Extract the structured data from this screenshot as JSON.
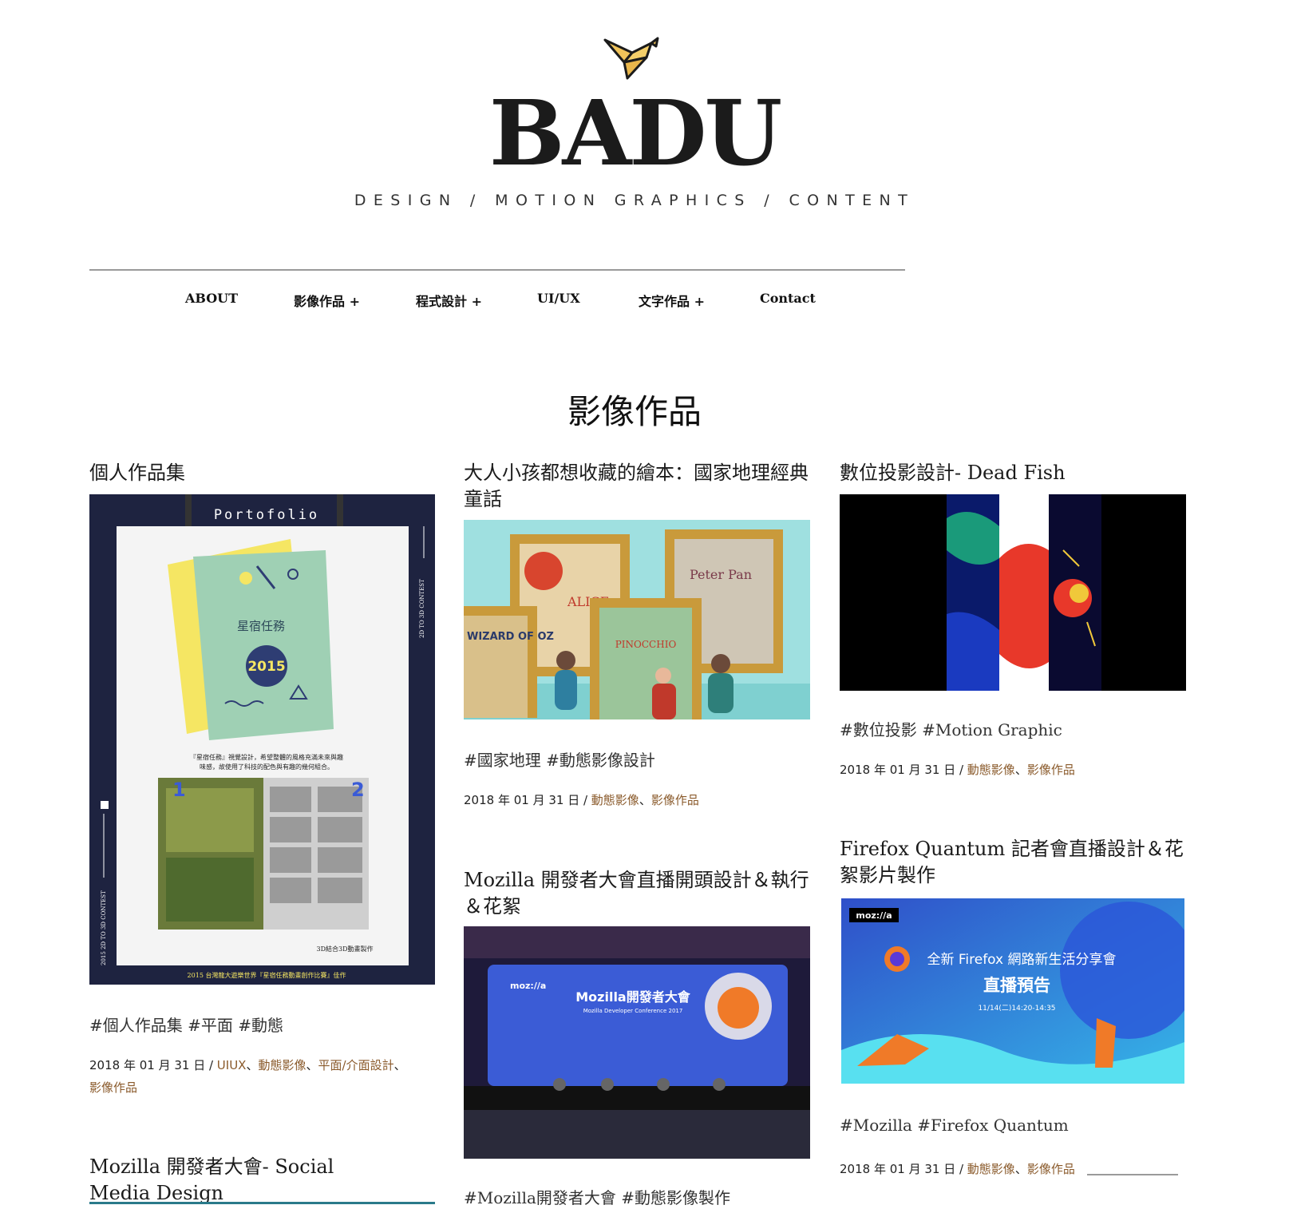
{
  "site": {
    "brand": "BADU",
    "tagline": "DESIGN / MOTION GRAPHICS / CONTENT"
  },
  "nav": [
    {
      "label": "ABOUT"
    },
    {
      "label": "影像作品 +"
    },
    {
      "label": "程式設計 +"
    },
    {
      "label": "UI/UX"
    },
    {
      "label": "文字作品 +"
    },
    {
      "label": "Contact"
    }
  ],
  "page": {
    "title": "影像作品"
  },
  "posts": [
    {
      "title": "個人作品集",
      "tags": "#個人作品集 #平面 #動態",
      "date": "2018 年 01 月 31 日",
      "sep": " / ",
      "categories": [
        "UIUX",
        "動態影像",
        "平面/介面設計",
        "影像作品"
      ],
      "thumb_text": {
        "heading": "Portofolio",
        "book_title": "星宿任務",
        "year": "2015",
        "left_num": "1",
        "right_num": "2",
        "side_text": "2D TO 3D CONTEST",
        "side_text_left": "2015 2D TO 3D CONTEST",
        "caption1": "『星宿任務』視覺設計，希望整體的風格充滿未來與趣",
        "caption2": "味感，故使用了科技的配色與有趣的幾何組合。",
        "caption3": "3D結合3D動畫製作",
        "footer": "2015 台灣龍大遊樂世界『星宿任務動畫創作比賽』佳作"
      }
    },
    {
      "title": "大人小孩都想收藏的繪本：國家地理經典童話",
      "tags": "#國家地理 #動態影像設計",
      "date": "2018 年 01 月 31 日",
      "sep": " / ",
      "categories": [
        "動態影像",
        "影像作品"
      ],
      "thumb_text": {
        "book1": "ALICE",
        "book2": "Peter Pan",
        "book3": "WIZARD OF OZ",
        "book4": "PINOCCHIO"
      }
    },
    {
      "title": "數位投影設計- Dead Fish",
      "tags": "#數位投影 #Motion Graphic",
      "date": "2018 年 01 月 31 日",
      "sep": " / ",
      "categories": [
        "動態影像",
        "影像作品"
      ]
    },
    {
      "title": "Mozilla 開發者大會直播開頭設計＆執行＆花絮",
      "tags": "#Mozilla開發者大會 #動態影像製作",
      "thumb_text": {
        "brand": "moz://a",
        "stage_title": "Mozilla開發者大會",
        "stage_sub": "Mozilla Developer Conference 2017"
      }
    },
    {
      "title": "Firefox Quantum 記者會直播設計＆花絮影片製作",
      "tags": "#Mozilla #Firefox Quantum",
      "date": "2018 年 01 月 31 日",
      "sep": " / ",
      "categories": [
        "動態影像",
        "影像作品"
      ],
      "thumb_text": {
        "brand": "moz://a",
        "line1": "全新 Firefox 網路新生活分享會",
        "line2": "直播預告",
        "line3": "11/14(二)14:20-14:35"
      }
    },
    {
      "title": "Mozilla 開發者大會- Social Media Design"
    }
  ],
  "colors": {
    "category_link": "#8a5a2b",
    "portfolio_bg": "#1e2340",
    "book_green": "#9fd0b4",
    "book_yellow": "#f5e663",
    "frame_gold": "#c99a3b",
    "gallery_bg": "#9fe0e0",
    "mozilla_blue": "#3b5cd6",
    "firefox_orange": "#f07a28"
  }
}
